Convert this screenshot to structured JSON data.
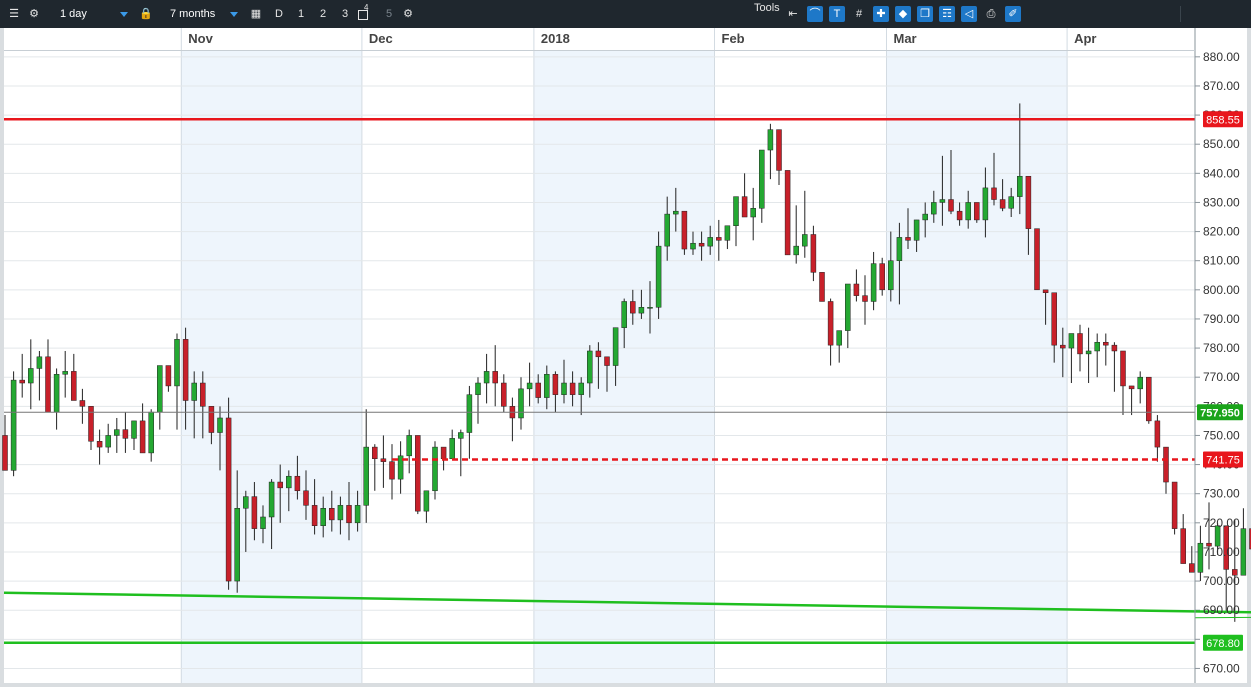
{
  "toolbar": {
    "interval": "1 day",
    "range": "7 months",
    "presets": [
      "D",
      "1",
      "2",
      "3",
      "4",
      "5"
    ],
    "tools_label": "Tools"
  },
  "chart_data": {
    "type": "candlestick",
    "x_labels": [
      "Nov",
      "Dec",
      "2018",
      "Feb",
      "Mar",
      "Apr"
    ],
    "ylim": [
      665,
      882
    ],
    "y_ticks": [
      880,
      870,
      860,
      850,
      840,
      830,
      820,
      810,
      800,
      790,
      780,
      770,
      760,
      750,
      740,
      730,
      720,
      710,
      700,
      690,
      680,
      670
    ],
    "y_tick_labels": [
      "880.00",
      "870.00",
      "860.00",
      "850.00",
      "840.00",
      "830.00",
      "820.00",
      "810.00",
      "800.00",
      "790.00",
      "780.00",
      "770.00",
      "760.00",
      "750.00",
      "740.00",
      "730.00",
      "720.00",
      "710.00",
      "700.00",
      "690.00",
      "680.00",
      "670.00"
    ],
    "grid": true,
    "current_price": {
      "value": 757.95,
      "label": "757.950",
      "color": "#1aa31a"
    },
    "horizontal_lines": [
      {
        "value": 858.55,
        "label": "858.55",
        "color": "#e8161c",
        "style": "solid"
      },
      {
        "value": 741.75,
        "label": "741.75",
        "color": "#e8161c",
        "style": "dashed"
      },
      {
        "value": 678.8,
        "label": "678.80",
        "color": "#1fbf1f",
        "style": "solid"
      }
    ],
    "trendline": {
      "from": [
        0,
        696
      ],
      "to": [
        173,
        688
      ],
      "color": "#1fbf1f"
    },
    "colors": {
      "up": "#24a832",
      "down": "#c8202a"
    },
    "candles": [
      [
        750,
        757,
        738,
        738
      ],
      [
        738,
        772,
        736,
        769
      ],
      [
        769,
        778,
        763,
        768
      ],
      [
        768,
        783,
        759,
        773
      ],
      [
        773,
        779,
        762,
        777
      ],
      [
        777,
        783,
        766,
        758
      ],
      [
        758,
        773,
        752,
        771
      ],
      [
        771,
        779,
        763,
        772
      ],
      [
        772,
        778,
        766,
        762
      ],
      [
        762,
        766,
        754,
        760
      ],
      [
        760,
        757,
        745,
        748
      ],
      [
        748,
        752,
        740,
        746
      ],
      [
        746,
        754,
        744,
        750
      ],
      [
        750,
        756,
        744,
        752
      ],
      [
        752,
        758,
        744,
        749
      ],
      [
        749,
        754,
        745,
        755
      ],
      [
        755,
        761,
        746,
        744
      ],
      [
        744,
        759,
        741,
        758
      ],
      [
        758,
        773,
        752,
        774
      ],
      [
        774,
        773,
        765,
        767
      ],
      [
        767,
        785,
        752,
        783
      ],
      [
        783,
        787,
        752,
        762
      ],
      [
        762,
        772,
        749,
        768
      ],
      [
        768,
        772,
        749,
        760
      ],
      [
        760,
        758,
        747,
        751
      ],
      [
        751,
        760,
        738,
        756
      ],
      [
        756,
        763,
        697,
        700
      ],
      [
        700,
        738,
        696,
        725
      ],
      [
        725,
        731,
        710,
        729
      ],
      [
        729,
        734,
        714,
        718
      ],
      [
        718,
        726,
        713,
        722
      ],
      [
        722,
        735,
        711,
        734
      ],
      [
        734,
        740,
        720,
        732
      ],
      [
        732,
        738,
        724,
        736
      ],
      [
        736,
        743,
        728,
        731
      ],
      [
        731,
        738,
        721,
        726
      ],
      [
        726,
        735,
        716,
        719
      ],
      [
        719,
        729,
        715,
        725
      ],
      [
        725,
        731,
        717,
        721
      ],
      [
        721,
        729,
        716,
        726
      ],
      [
        726,
        734,
        714,
        720
      ],
      [
        720,
        731,
        717,
        726
      ],
      [
        726,
        759,
        720,
        746
      ],
      [
        746,
        747,
        731,
        742
      ],
      [
        742,
        750,
        732,
        741
      ],
      [
        741,
        747,
        728,
        735
      ],
      [
        735,
        748,
        730,
        743
      ],
      [
        743,
        752,
        737,
        750
      ],
      [
        750,
        736,
        723,
        724
      ],
      [
        724,
        731,
        720,
        731
      ],
      [
        731,
        748,
        728,
        746
      ],
      [
        746,
        741,
        738,
        742
      ],
      [
        742,
        752,
        742,
        749
      ],
      [
        749,
        752,
        736,
        751
      ],
      [
        751,
        767,
        742,
        764
      ],
      [
        764,
        770,
        754,
        768
      ],
      [
        768,
        778,
        761,
        772
      ],
      [
        772,
        781,
        760,
        768
      ],
      [
        768,
        771,
        758,
        760
      ],
      [
        760,
        763,
        748,
        756
      ],
      [
        756,
        770,
        752,
        766
      ],
      [
        766,
        775,
        760,
        768
      ],
      [
        768,
        771,
        761,
        763
      ],
      [
        763,
        774,
        759,
        771
      ],
      [
        771,
        772,
        758,
        764
      ],
      [
        764,
        776,
        761,
        768
      ],
      [
        768,
        772,
        760,
        764
      ],
      [
        764,
        770,
        757,
        768
      ],
      [
        768,
        781,
        763,
        779
      ],
      [
        779,
        782,
        766,
        777
      ],
      [
        777,
        772,
        765,
        774
      ],
      [
        774,
        786,
        767,
        787
      ],
      [
        787,
        797,
        780,
        796
      ],
      [
        796,
        800,
        788,
        792
      ],
      [
        792,
        800,
        790,
        794
      ],
      [
        794,
        803,
        785,
        794
      ],
      [
        794,
        820,
        790,
        815
      ],
      [
        815,
        832,
        810,
        826
      ],
      [
        826,
        835,
        820,
        827
      ],
      [
        827,
        820,
        812,
        814
      ],
      [
        814,
        820,
        812,
        816
      ],
      [
        816,
        820,
        810,
        815
      ],
      [
        815,
        822,
        812,
        818
      ],
      [
        818,
        824,
        810,
        817
      ],
      [
        817,
        820,
        814,
        822
      ],
      [
        822,
        830,
        815,
        832
      ],
      [
        832,
        840,
        828,
        825
      ],
      [
        825,
        835,
        817,
        828
      ],
      [
        828,
        842,
        823,
        848
      ],
      [
        848,
        857,
        838,
        855
      ],
      [
        855,
        848,
        836,
        841
      ],
      [
        841,
        826,
        812,
        812
      ],
      [
        812,
        829,
        809,
        815
      ],
      [
        815,
        834,
        811,
        819
      ],
      [
        819,
        822,
        803,
        806
      ],
      [
        806,
        803,
        797,
        796
      ],
      [
        796,
        797,
        774,
        781
      ],
      [
        781,
        786,
        775,
        786
      ],
      [
        786,
        794,
        780,
        802
      ],
      [
        802,
        807,
        796,
        798
      ],
      [
        798,
        805,
        788,
        796
      ],
      [
        796,
        813,
        793,
        809
      ],
      [
        809,
        811,
        798,
        800
      ],
      [
        800,
        820,
        796,
        810
      ],
      [
        810,
        823,
        795,
        818
      ],
      [
        818,
        828,
        814,
        817
      ],
      [
        817,
        822,
        813,
        824
      ],
      [
        824,
        830,
        818,
        826
      ],
      [
        826,
        834,
        823,
        830
      ],
      [
        830,
        846,
        822,
        831
      ],
      [
        831,
        848,
        826,
        827
      ],
      [
        827,
        830,
        822,
        824
      ],
      [
        824,
        834,
        821,
        830
      ],
      [
        830,
        830,
        823,
        824
      ],
      [
        824,
        842,
        818,
        835
      ],
      [
        835,
        847,
        829,
        831
      ],
      [
        831,
        838,
        827,
        828
      ],
      [
        828,
        835,
        825,
        832
      ],
      [
        832,
        864,
        826,
        839
      ],
      [
        839,
        834,
        812,
        821
      ],
      [
        821,
        814,
        803,
        800
      ],
      [
        800,
        798,
        788,
        799
      ],
      [
        799,
        791,
        775,
        781
      ],
      [
        781,
        787,
        770,
        780
      ],
      [
        780,
        785,
        768,
        785
      ],
      [
        785,
        788,
        772,
        778
      ],
      [
        778,
        787,
        768,
        779
      ],
      [
        779,
        785,
        770,
        782
      ],
      [
        782,
        785,
        774,
        781
      ],
      [
        781,
        782,
        765,
        779
      ],
      [
        779,
        775,
        757,
        767
      ],
      [
        767,
        767,
        757,
        766
      ],
      [
        766,
        772,
        761,
        770
      ],
      [
        770,
        769,
        754,
        755
      ],
      [
        755,
        757,
        741,
        746
      ],
      [
        746,
        739,
        730,
        734
      ],
      [
        734,
        732,
        716,
        718
      ],
      [
        718,
        723,
        708,
        706
      ],
      [
        706,
        712,
        705,
        703
      ],
      [
        703,
        719,
        700,
        713
      ],
      [
        713,
        727,
        704,
        712
      ],
      [
        712,
        720,
        709,
        719
      ],
      [
        719,
        703,
        689,
        704
      ],
      [
        704,
        721,
        686,
        702
      ],
      [
        702,
        725,
        702,
        718
      ],
      [
        718,
        724,
        712,
        711
      ],
      [
        711,
        709,
        705,
        708
      ],
      [
        708,
        729,
        715,
        722
      ],
      [
        722,
        738,
        720,
        729
      ],
      [
        729,
        738,
        727,
        732
      ],
      [
        732,
        730,
        727,
        726
      ],
      [
        726,
        732,
        720,
        728
      ],
      [
        728,
        732,
        722,
        730
      ],
      [
        730,
        742,
        728,
        731
      ],
      [
        731,
        745,
        731,
        748
      ],
      [
        748,
        758,
        748,
        758
      ]
    ]
  }
}
